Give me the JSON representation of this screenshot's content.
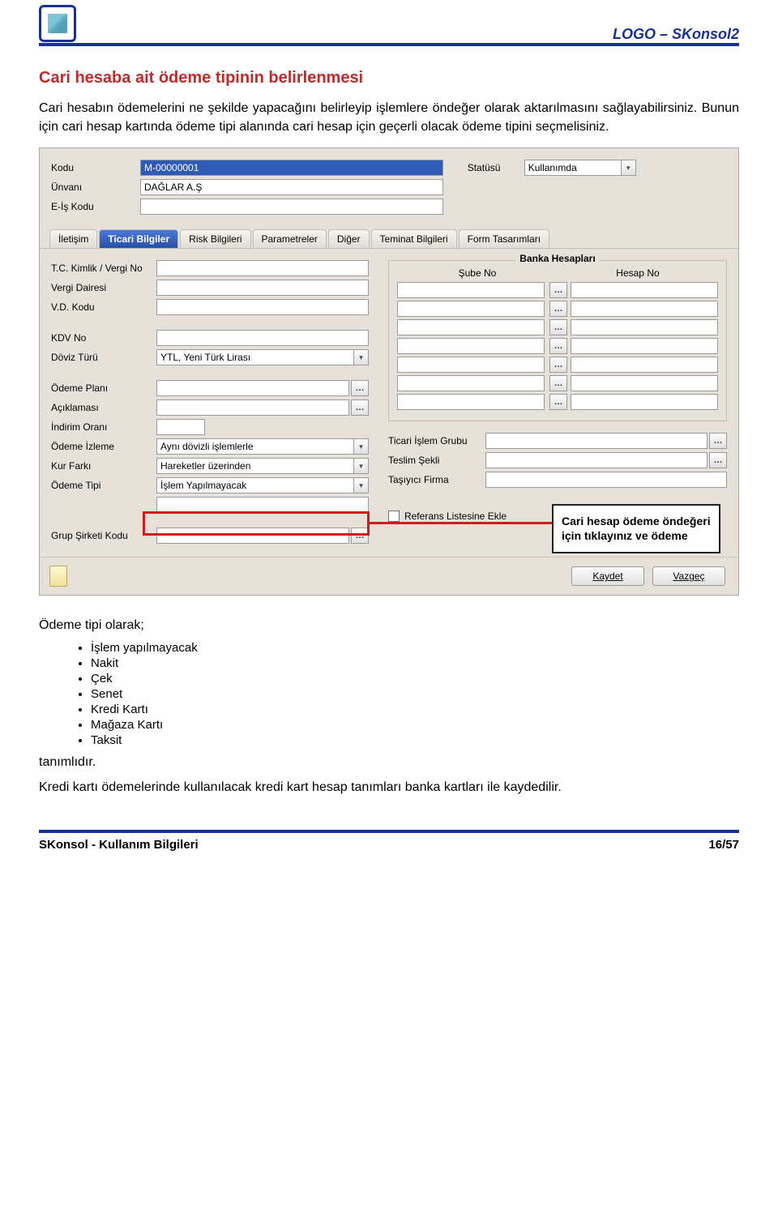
{
  "header": {
    "product": "LOGO – SKonsol2"
  },
  "section": {
    "title": "Cari hesaba ait ödeme tipinin belirlenmesi",
    "para1": "Cari hesabın ödemelerini ne şekilde yapacağını belirleyip işlemlere öndeğer olarak aktarılmasını sağlayabilirsiniz. Bunun için cari hesap kartında ödeme tipi alanında cari hesap için geçerli olacak ödeme tipini seçmelisiniz."
  },
  "form": {
    "labels": {
      "kodu": "Kodu",
      "unvani": "Ünvanı",
      "eiskodu": "E-İş Kodu",
      "statusu": "Statüsü"
    },
    "values": {
      "kodu": "M-00000001",
      "unvani": "DAĞLAR A.Ş",
      "statusu": "Kullanımda"
    },
    "tabs": [
      "İletişim",
      "Ticari Bilgiler",
      "Risk Bilgileri",
      "Parametreler",
      "Diğer",
      "Teminat Bilgileri",
      "Form Tasarımları"
    ],
    "left_labels": {
      "tcvergi": "T.C. Kimlik / Vergi No",
      "vdairesi": "Vergi Dairesi",
      "vdkodu": "V.D. Kodu",
      "kdvno": "KDV No",
      "doviz": "Döviz Türü",
      "odemeplani": "Ödeme Planı",
      "aciklamasi": "Açıklaması",
      "indorani": "İndirim Oranı",
      "odemeizleme": "Ödeme İzleme",
      "kurfarki": "Kur Farkı",
      "odemetipi": "Ödeme Tipi",
      "grupsirket": "Grup Şirketi Kodu"
    },
    "left_values": {
      "doviz": "YTL, Yeni Türk Lirası",
      "odemeizleme": "Aynı dövizli işlemlerle",
      "kurfarki": "Hareketler üzerinden",
      "odemetipi": "İşlem Yapılmayacak"
    },
    "right_panel": {
      "group_title": "Banka Hesapları",
      "col_sube": "Şube No",
      "col_hesap": "Hesap No",
      "ticariislem": "Ticari İşlem Grubu",
      "teslimsekli": "Teslim Şekli",
      "tasiyici": "Taşıyıcı Firma",
      "referans": "Referans Listesine Ekle"
    },
    "buttons": {
      "kaydet": "Kaydet",
      "vazgec": "Vazgeç"
    },
    "callout": "Cari hesap ödeme öndeğeri için tıklayınız ve ödeme"
  },
  "body2": {
    "intro": "Ödeme tipi olarak;",
    "items": [
      "İşlem yapılmayacak",
      "Nakit",
      "Çek",
      "Senet",
      "Kredi Kartı",
      "Mağaza Kartı",
      "Taksit"
    ],
    "outro": "tanımlıdır.",
    "final": "Kredi kartı ödemelerinde kullanılacak kredi kart hesap tanımları banka kartları ile kaydedilir."
  },
  "footer": {
    "left": "SKonsol - Kullanım Bilgileri",
    "right": "16/57"
  }
}
